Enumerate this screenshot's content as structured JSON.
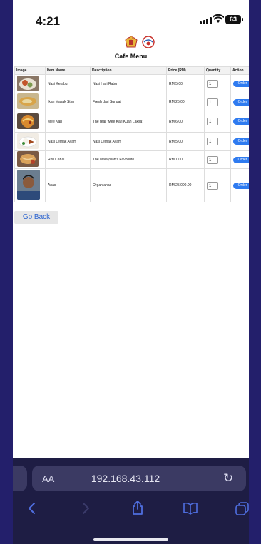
{
  "status": {
    "time": "4:21",
    "battery": "63"
  },
  "page": {
    "title": "Cafe Menu",
    "columns": [
      "Image",
      "Item Name",
      "Description",
      "Price (RM)",
      "Quantity",
      "Action"
    ],
    "rows": [
      {
        "name": "Nasi Kerabu",
        "desc": "Nasi Hari Rabu",
        "price": "RM 5.00",
        "qty": "1",
        "action": "Order"
      },
      {
        "name": "Ikan Masak Stim",
        "desc": "Fresh dari Sungai",
        "price": "RM 25.00",
        "qty": "1",
        "action": "Order"
      },
      {
        "name": "Mee Kari",
        "desc": "The real \"Mee Kari Kuah Laksa\"",
        "price": "RM 6.00",
        "qty": "1",
        "action": "Order"
      },
      {
        "name": "Nasi Lemak Ayam",
        "desc": "Nasi Lemak Ayam",
        "price": "RM 5.00",
        "qty": "1",
        "action": "Order"
      },
      {
        "name": "Roti Canai",
        "desc": "The Malaysian's Favourite",
        "price": "RM 1.00",
        "qty": "1",
        "action": "Order"
      },
      {
        "name": "Anas",
        "desc": "Organ anas",
        "price": "RM 25,000.00",
        "qty": "1",
        "action": "Order"
      }
    ],
    "go_back": "Go Back"
  },
  "browser": {
    "aa": "AA",
    "url": "192.168.43.112"
  },
  "colors": {
    "accent": "#2f7bf0",
    "frame": "#231f6b",
    "browser_bar": "#1e1d44"
  }
}
